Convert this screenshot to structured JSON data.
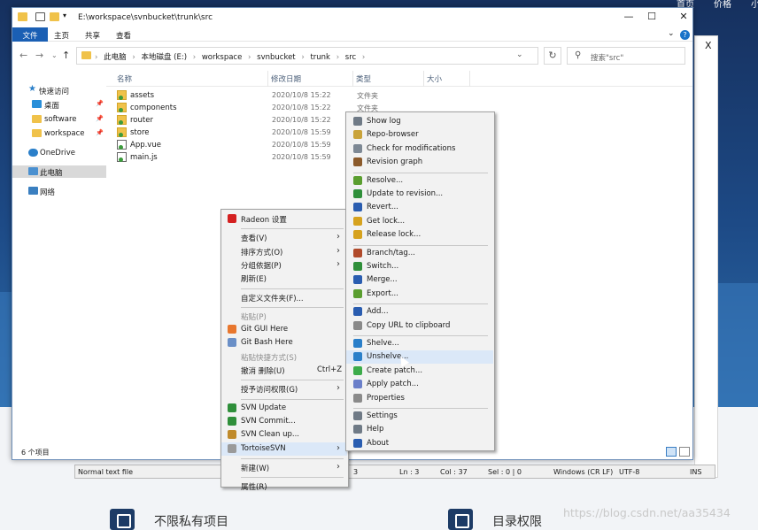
{
  "website": {
    "top_nav": [
      "首页",
      "价格",
      "小"
    ],
    "features": [
      "不限私有项目",
      "目录权限"
    ],
    "watermark": "https://blog.csdn.net/aa35434"
  },
  "explorer": {
    "title_path": "E:\\workspace\\svnbucket\\trunk\\src",
    "ribbon_tabs": [
      "文件",
      "主页",
      "共享",
      "查看"
    ],
    "breadcrumbs": [
      "此电脑",
      "本地磁盘 (E:)",
      "workspace",
      "svnbucket",
      "trunk",
      "src"
    ],
    "search_placeholder": "搜索\"src\"",
    "nav_pane": [
      {
        "label": "快速访问",
        "icon": "star-icon"
      },
      {
        "label": "桌面",
        "icon": "desktop-icon",
        "pinned": true
      },
      {
        "label": "software",
        "icon": "folder-icon",
        "pinned": true
      },
      {
        "label": "workspace",
        "icon": "folder-icon",
        "pinned": true
      },
      {
        "label": "OneDrive",
        "icon": "cloud-icon"
      },
      {
        "label": "此电脑",
        "icon": "computer-icon",
        "selected": true
      },
      {
        "label": "网络",
        "icon": "network-icon"
      }
    ],
    "columns": [
      "名称",
      "修改日期",
      "类型",
      "大小"
    ],
    "files": [
      {
        "name": "assets",
        "date": "2020/10/8 15:22",
        "type": "文件夹",
        "kind": "folder"
      },
      {
        "name": "components",
        "date": "2020/10/8 15:22",
        "type": "文件夹",
        "kind": "folder"
      },
      {
        "name": "router",
        "date": "2020/10/8 15:22",
        "type": "",
        "kind": "folder"
      },
      {
        "name": "store",
        "date": "2020/10/8 15:59",
        "type": "",
        "kind": "folder"
      },
      {
        "name": "App.vue",
        "date": "2020/10/8 15:59",
        "type": "",
        "kind": "file"
      },
      {
        "name": "main.js",
        "date": "2020/10/8 15:59",
        "type": "",
        "kind": "file"
      }
    ],
    "item_count": "6 个项目"
  },
  "context_menu": {
    "items": [
      {
        "label": "Radeon 设置",
        "icon": "radeon-icon",
        "icon_color": "#d42020"
      },
      {
        "sep": true
      },
      {
        "label": "查看(V)",
        "submenu": true
      },
      {
        "label": "排序方式(O)",
        "submenu": true
      },
      {
        "label": "分组依据(P)",
        "submenu": true
      },
      {
        "label": "刷新(E)"
      },
      {
        "sep": true
      },
      {
        "label": "自定义文件夹(F)..."
      },
      {
        "sep": true
      },
      {
        "label": "粘贴(P)",
        "disabled": true
      },
      {
        "label": "Git GUI Here",
        "icon": "git-gui-icon",
        "icon_color": "#e8772e"
      },
      {
        "label": "Git Bash Here",
        "icon": "git-bash-icon",
        "icon_color": "#6a8fc7"
      },
      {
        "label": "粘贴快捷方式(S)",
        "disabled": true
      },
      {
        "label": "撤消 删除(U)",
        "shortcut": "Ctrl+Z"
      },
      {
        "sep": true
      },
      {
        "label": "授予访问权限(G)",
        "submenu": true
      },
      {
        "sep": true
      },
      {
        "label": "SVN Update",
        "icon": "svn-update-icon",
        "icon_color": "#2f8f3a"
      },
      {
        "label": "SVN Commit...",
        "icon": "svn-commit-icon",
        "icon_color": "#2f8f3a"
      },
      {
        "label": "SVN Clean up...",
        "icon": "svn-cleanup-icon",
        "icon_color": "#c08a2a"
      },
      {
        "label": "TortoiseSVN",
        "icon": "tortoisesvn-icon",
        "icon_color": "#9a9a9a",
        "submenu": true,
        "highlight": true
      },
      {
        "sep": true
      },
      {
        "label": "新建(W)",
        "submenu": true
      },
      {
        "sep": true
      },
      {
        "label": "属性(R)"
      }
    ]
  },
  "svn_menu": {
    "items": [
      {
        "label": "Show log",
        "icon": "show-log-icon",
        "icon_color": "#6f7a86"
      },
      {
        "label": "Repo-browser",
        "icon": "repo-browser-icon",
        "icon_color": "#c9a33a"
      },
      {
        "label": "Check for modifications",
        "icon": "check-modifications-icon",
        "icon_color": "#7d8894"
      },
      {
        "label": "Revision graph",
        "icon": "revision-graph-icon",
        "icon_color": "#8b5a2b"
      },
      {
        "sep": true
      },
      {
        "label": "Resolve...",
        "icon": "resolve-icon",
        "icon_color": "#5a9e2f"
      },
      {
        "label": "Update to revision...",
        "icon": "update-revision-icon",
        "icon_color": "#2f8f3a"
      },
      {
        "label": "Revert...",
        "icon": "revert-icon",
        "icon_color": "#2a5db0"
      },
      {
        "label": "Get lock...",
        "icon": "get-lock-icon",
        "icon_color": "#d6a21e"
      },
      {
        "label": "Release lock...",
        "icon": "release-lock-icon",
        "icon_color": "#d6a21e"
      },
      {
        "sep": true
      },
      {
        "label": "Branch/tag...",
        "icon": "branch-tag-icon",
        "icon_color": "#b04a2a"
      },
      {
        "label": "Switch...",
        "icon": "switch-icon",
        "icon_color": "#2f8f3a"
      },
      {
        "label": "Merge...",
        "icon": "merge-icon",
        "icon_color": "#2a5db0"
      },
      {
        "label": "Export...",
        "icon": "export-icon",
        "icon_color": "#5a9e2f"
      },
      {
        "sep": true
      },
      {
        "label": "Add...",
        "icon": "add-icon",
        "icon_color": "#2a5db0"
      },
      {
        "label": "Copy URL to clipboard",
        "icon": "copy-url-icon",
        "icon_color": "#8a8a8a"
      },
      {
        "sep": true
      },
      {
        "label": "Shelve...",
        "icon": "shelve-icon",
        "icon_color": "#2a7fc9"
      },
      {
        "label": "Unshelve...",
        "icon": "unshelve-icon",
        "icon_color": "#2a7fc9",
        "highlight": true
      },
      {
        "label": "Create patch...",
        "icon": "create-patch-icon",
        "icon_color": "#3cab4a"
      },
      {
        "label": "Apply patch...",
        "icon": "apply-patch-icon",
        "icon_color": "#6a7fc9"
      },
      {
        "label": "Properties",
        "icon": "properties-icon",
        "icon_color": "#8a8a8a"
      },
      {
        "sep": true
      },
      {
        "label": "Settings",
        "icon": "settings-icon",
        "icon_color": "#6f7a86"
      },
      {
        "label": "Help",
        "icon": "help-icon",
        "icon_color": "#6f7a86"
      },
      {
        "label": "About",
        "icon": "about-icon",
        "icon_color": "#2a5db0"
      }
    ]
  },
  "notepad_status": {
    "mode": "Normal text file",
    "num": "3",
    "ln": "Ln : 3",
    "col": "Col : 37",
    "sel": "Sel : 0 | 0",
    "eol": "Windows (CR LF)",
    "encoding": "UTF-8",
    "ins": "INS"
  },
  "back_window_close": "X"
}
